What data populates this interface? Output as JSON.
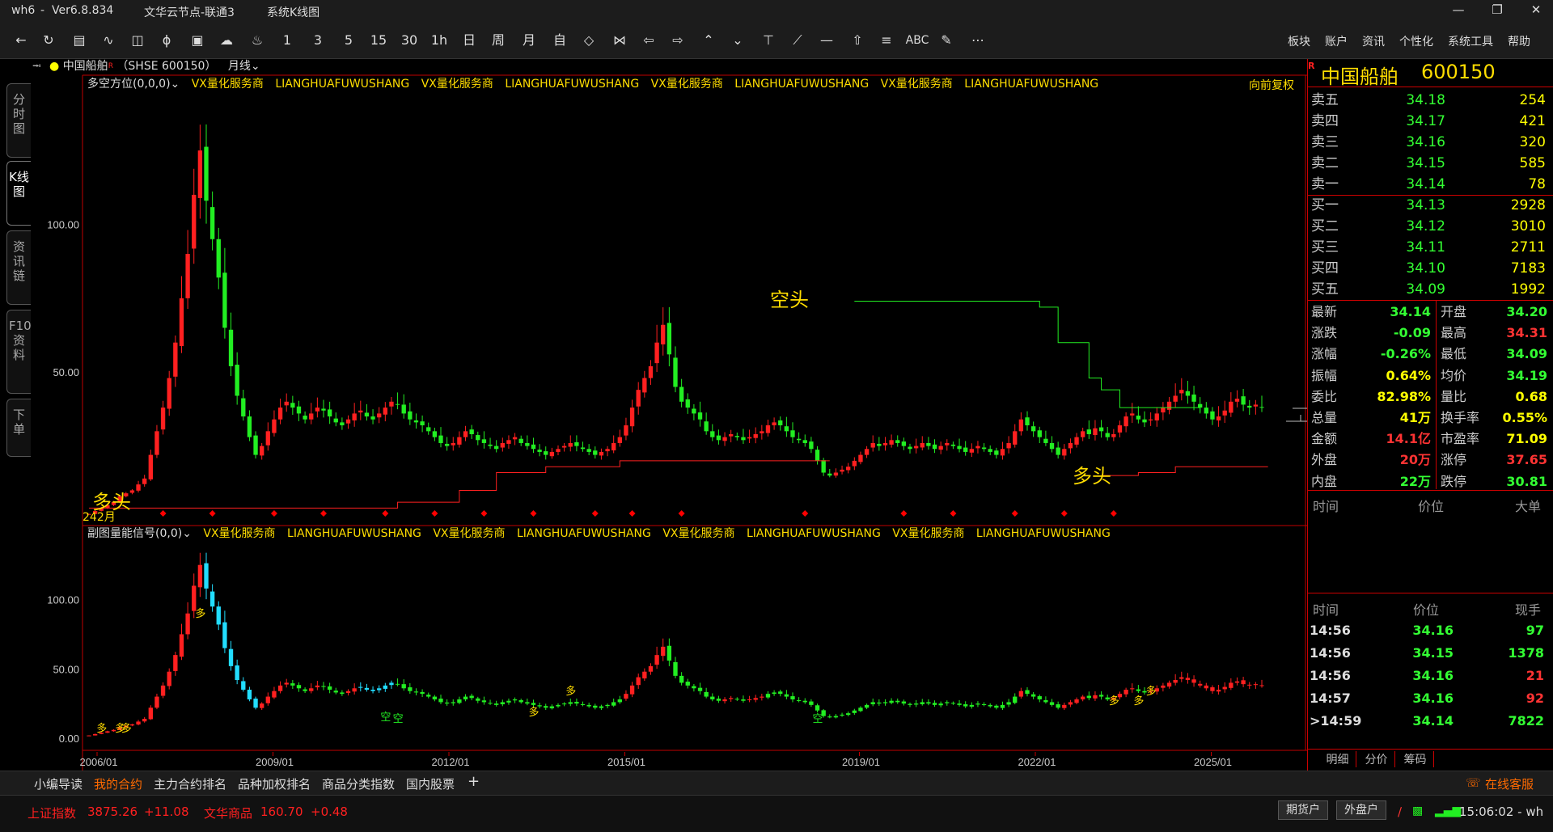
{
  "window": {
    "app": "wh6",
    "version": "Ver6.8.834",
    "server": "文华云节点-联通3",
    "view": "系统K线图"
  },
  "toolbar": {
    "periods": [
      "1",
      "3",
      "5",
      "15",
      "30",
      "1h",
      "日",
      "周",
      "月",
      "自"
    ],
    "misc_text": "ABC",
    "menus": [
      "板块",
      "账户",
      "资讯",
      "个性化",
      "系统工具",
      "帮助"
    ]
  },
  "leftnav": {
    "tabs": [
      "分时图",
      "K线图",
      "资讯链",
      "F10资料",
      "下单"
    ],
    "active_index": 1
  },
  "chart_header": {
    "symbol": "中国船舶",
    "code": "（SHSE 600150）",
    "period": "月线",
    "main_indicator": "多空方位(0,0,0)",
    "watermark_a": "VX量化服务商",
    "watermark_b": "LIANGHUAFUWUSHANG",
    "adjust": "向前复权",
    "sub_indicator": "副图量能信号(0,0)"
  },
  "chart_labels": {
    "kong": "空头",
    "duo_main": "多头",
    "duo_left": "多头",
    "bar_count": "242月",
    "sig_duo": "多",
    "sig_kong": "空"
  },
  "chart_data": {
    "type": "candlestick",
    "main_panel": {
      "y_ticks": [
        "100.00",
        "50.00"
      ],
      "ylim": [
        0,
        145
      ]
    },
    "sub_panel": {
      "y_ticks": [
        "100.00",
        "50.00",
        "0.00"
      ]
    },
    "x_ticks": [
      "2006/01",
      "2009/01",
      "2012/01",
      "2015/01",
      "2019/01",
      "2022/01",
      "2025/01"
    ],
    "series_close": [
      2,
      3,
      4,
      5,
      6,
      8,
      9,
      10,
      12,
      14,
      22,
      30,
      38,
      48,
      60,
      75,
      90,
      110,
      125,
      108,
      95,
      82,
      65,
      52,
      42,
      35,
      28,
      22,
      25,
      30,
      34,
      38,
      40,
      38,
      36,
      34,
      36,
      38,
      37,
      35,
      33,
      32,
      34,
      36,
      37,
      35,
      34,
      36,
      38,
      40,
      39,
      36,
      34,
      33,
      32,
      30,
      28,
      26,
      25,
      26,
      28,
      30,
      29,
      27,
      26,
      25,
      24,
      26,
      27,
      28,
      26,
      25,
      24,
      23,
      22,
      23,
      24,
      25,
      26,
      25,
      24,
      23,
      22,
      23,
      24,
      26,
      28,
      32,
      38,
      44,
      48,
      52,
      60,
      66,
      56,
      45,
      40,
      38,
      36,
      34,
      30,
      28,
      27,
      28,
      29,
      28,
      27,
      28,
      29,
      30,
      32,
      33,
      32,
      30,
      28,
      27,
      26,
      24,
      20,
      16,
      15,
      16,
      17,
      18,
      20,
      22,
      24,
      26,
      25,
      26,
      27,
      26,
      25,
      24,
      25,
      26,
      25,
      24,
      25,
      26,
      25,
      24,
      23,
      24,
      25,
      24,
      23,
      22,
      24,
      26,
      30,
      34,
      32,
      30,
      28,
      26,
      24,
      22,
      24,
      26,
      28,
      30,
      29,
      31,
      30,
      28,
      29,
      32,
      35,
      36,
      34,
      33,
      34,
      36,
      38,
      40,
      42,
      44,
      42,
      40,
      38,
      36,
      34,
      35,
      37,
      40,
      41,
      39,
      38,
      39,
      38
    ],
    "upper_line_label": "空头",
    "lower_line_label": "多头"
  },
  "quote": {
    "name": "中国船舶",
    "code": "600150",
    "asks": [
      {
        "label": "卖五",
        "price": "34.18",
        "vol": "254"
      },
      {
        "label": "卖四",
        "price": "34.17",
        "vol": "421"
      },
      {
        "label": "卖三",
        "price": "34.16",
        "vol": "320"
      },
      {
        "label": "卖二",
        "price": "34.15",
        "vol": "585"
      },
      {
        "label": "卖一",
        "price": "34.14",
        "vol": "78"
      }
    ],
    "bids": [
      {
        "label": "买一",
        "price": "34.13",
        "vol": "2928"
      },
      {
        "label": "买二",
        "price": "34.12",
        "vol": "3010"
      },
      {
        "label": "买三",
        "price": "34.11",
        "vol": "2711"
      },
      {
        "label": "买四",
        "price": "34.10",
        "vol": "7183"
      },
      {
        "label": "买五",
        "price": "34.09",
        "vol": "1992"
      }
    ],
    "stats": [
      {
        "l1": "最新",
        "v1": "34.14",
        "c1": "#3f3",
        "l2": "开盘",
        "v2": "34.20",
        "c2": "#3f3"
      },
      {
        "l1": "涨跌",
        "v1": "-0.09",
        "c1": "#3f3",
        "l2": "最高",
        "v2": "34.31",
        "c2": "#f33"
      },
      {
        "l1": "涨幅",
        "v1": "-0.26%",
        "c1": "#3f3",
        "l2": "最低",
        "v2": "34.09",
        "c2": "#3f3"
      },
      {
        "l1": "振幅",
        "v1": "0.64%",
        "c1": "#ff0",
        "l2": "均价",
        "v2": "34.19",
        "c2": "#3f3"
      },
      {
        "l1": "委比",
        "v1": "82.98%",
        "c1": "#ff0",
        "l2": "量比",
        "v2": "0.68",
        "c2": "#ff0"
      },
      {
        "l1": "总量",
        "v1": "41万",
        "c1": "#ff0",
        "l2": "换手率",
        "v2": "0.55%",
        "c2": "#ff0"
      },
      {
        "l1": "金额",
        "v1": "14.1亿",
        "c1": "#f33",
        "l2": "市盈率",
        "v2": "71.09",
        "c2": "#ff0"
      },
      {
        "l1": "外盘",
        "v1": "20万",
        "c1": "#f33",
        "l2": "涨停",
        "v2": "37.65",
        "c2": "#f33"
      },
      {
        "l1": "内盘",
        "v1": "22万",
        "c1": "#3f3",
        "l2": "跌停",
        "v2": "30.81",
        "c2": "#3f3"
      }
    ],
    "big_hdr": [
      "时间",
      "价位",
      "大单"
    ],
    "tick_hdr": [
      "时间",
      "价位",
      "现手"
    ],
    "ticks": [
      {
        "t": "14:56",
        "p": "34.16",
        "v": "97",
        "vc": "#3f3"
      },
      {
        "t": "14:56",
        "p": "34.15",
        "v": "1378",
        "vc": "#3f3"
      },
      {
        "t": "14:56",
        "p": "34.16",
        "v": "21",
        "vc": "#f33"
      },
      {
        "t": "14:57",
        "p": "34.16",
        "v": "92",
        "vc": "#f33"
      },
      {
        "t": ">14:59",
        "p": "34.14",
        "v": "7822",
        "vc": "#3f3"
      }
    ],
    "tabs": [
      "明细",
      "分价",
      "筹码"
    ]
  },
  "bottom": {
    "tabs": [
      "小编导读",
      "我的合约",
      "主力合约排名",
      "品种加权排名",
      "商品分类指数",
      "国内股票",
      "+"
    ],
    "active": 1,
    "service": "在线客服"
  },
  "status": {
    "idx1_name": "上证指数",
    "idx1_val": "3875.26",
    "idx1_chg": "+11.08",
    "idx2_name": "文华商品",
    "idx2_val": "160.70",
    "idx2_chg": "+0.48",
    "btn_futures": "期货户",
    "btn_outer": "外盘户",
    "time": "15:06:02 - wh"
  },
  "colors": {
    "up": "#ff2020",
    "down": "#22ee22",
    "cyan": "#22ddff",
    "axis_red": "#c00000",
    "text_yellow": "#ffdd00"
  }
}
